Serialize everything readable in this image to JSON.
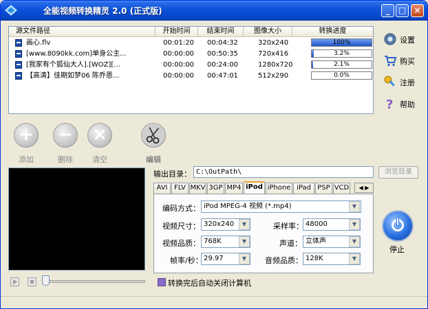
{
  "window": {
    "title": "全能视频转换精灵 2.0 (正式版)",
    "min": "_",
    "max": "□",
    "close": "×"
  },
  "list": {
    "headers": [
      "源文件路径",
      "开始时间",
      "结束时间",
      "图像大小",
      "转换进度"
    ],
    "rows": [
      {
        "path": "画心.flv",
        "start": "00:01:20",
        "end": "00:04:32",
        "size": "320x240",
        "progress": 100,
        "progress_text": "100%"
      },
      {
        "path": "[www.8090kk.com]单身公主...",
        "start": "00:00:00",
        "end": "00:50:35",
        "size": "720x416",
        "progress": 3.2,
        "progress_text": "3.2%"
      },
      {
        "path": "[我家有个狐仙大人].[WOZ][...",
        "start": "00:00:00",
        "end": "00:24:00",
        "size": "1280x720",
        "progress": 2.1,
        "progress_text": "2.1%"
      },
      {
        "path": "【高清】佳期如梦06 陈乔恩...",
        "start": "00:00:00",
        "end": "00:47:01",
        "size": "512x290",
        "progress": 0,
        "progress_text": "0.0%"
      }
    ]
  },
  "side": {
    "settings": "设置",
    "buy": "购买",
    "register": "注册",
    "help": "帮助"
  },
  "toolbar": {
    "add": "添加",
    "delete": "删除",
    "clear": "清空",
    "edit": "编辑"
  },
  "output": {
    "label": "输出目录：",
    "path": "C:\\OutPath\\",
    "browse": "浏览目录"
  },
  "tabs": [
    "AVI",
    "FLV",
    "MKV",
    "3GP",
    "MP4",
    "iPod",
    "iPhone",
    "iPad",
    "PSP",
    "VCD"
  ],
  "active_tab": "iPod",
  "tab_scroll": "◀ ▶",
  "settings_panel": {
    "codec_label": "编码方式：",
    "codec_value": "iPod MPEG-4 视频 (*.mp4)",
    "size_label": "视频尺寸：",
    "size_value": "320x240",
    "sample_label": "采样率：",
    "sample_value": "48000",
    "quality_label": "视频品质：",
    "quality_value": "768K",
    "channel_label": "声道：",
    "channel_value": "立体声",
    "fps_label": "帧率/秒：",
    "fps_value": "29.97",
    "audio_label": "音频品质：",
    "audio_value": "128K"
  },
  "shutdown_label": "转换完后自动关闭计算机",
  "stop_label": "停止",
  "colors": {
    "titlebar": "#0a52d8",
    "progress": "#1f52c8",
    "background": "#ece9d8"
  }
}
